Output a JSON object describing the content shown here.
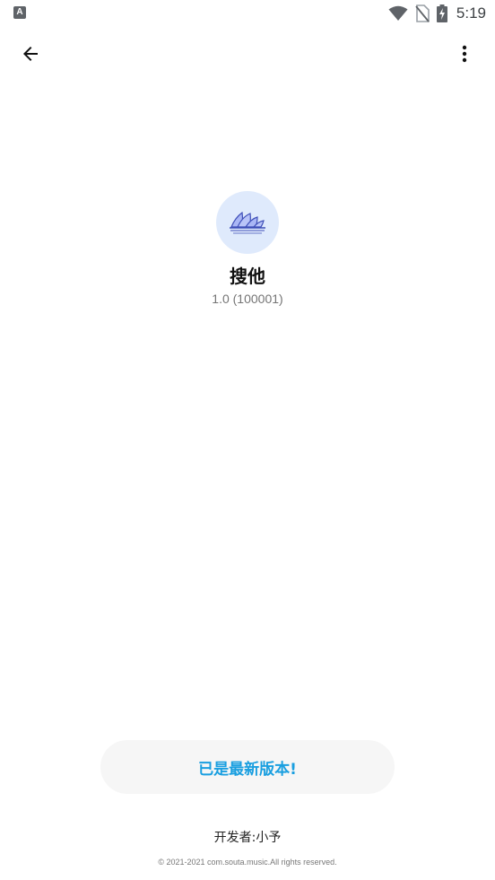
{
  "status_bar": {
    "left_icon": "A",
    "icons": [
      "wifi-icon",
      "no-sim-icon",
      "battery-charging-icon"
    ],
    "time": "5:19"
  },
  "app_bar": {
    "back_icon": "arrow-back-icon",
    "menu_icon": "more-vert-icon"
  },
  "app": {
    "logo_icon": "opera-house-icon",
    "name": "搜他",
    "version": "1.0 (100001)"
  },
  "update_button": {
    "label": "已是最新版本!"
  },
  "footer": {
    "developer": "开发者:小予",
    "copyright": "© 2021-2021 com.souta.music.All rights reserved."
  },
  "colors": {
    "accent": "#1a9fe0",
    "logo_background": "#dfeafc",
    "button_background": "#f6f6f6"
  }
}
